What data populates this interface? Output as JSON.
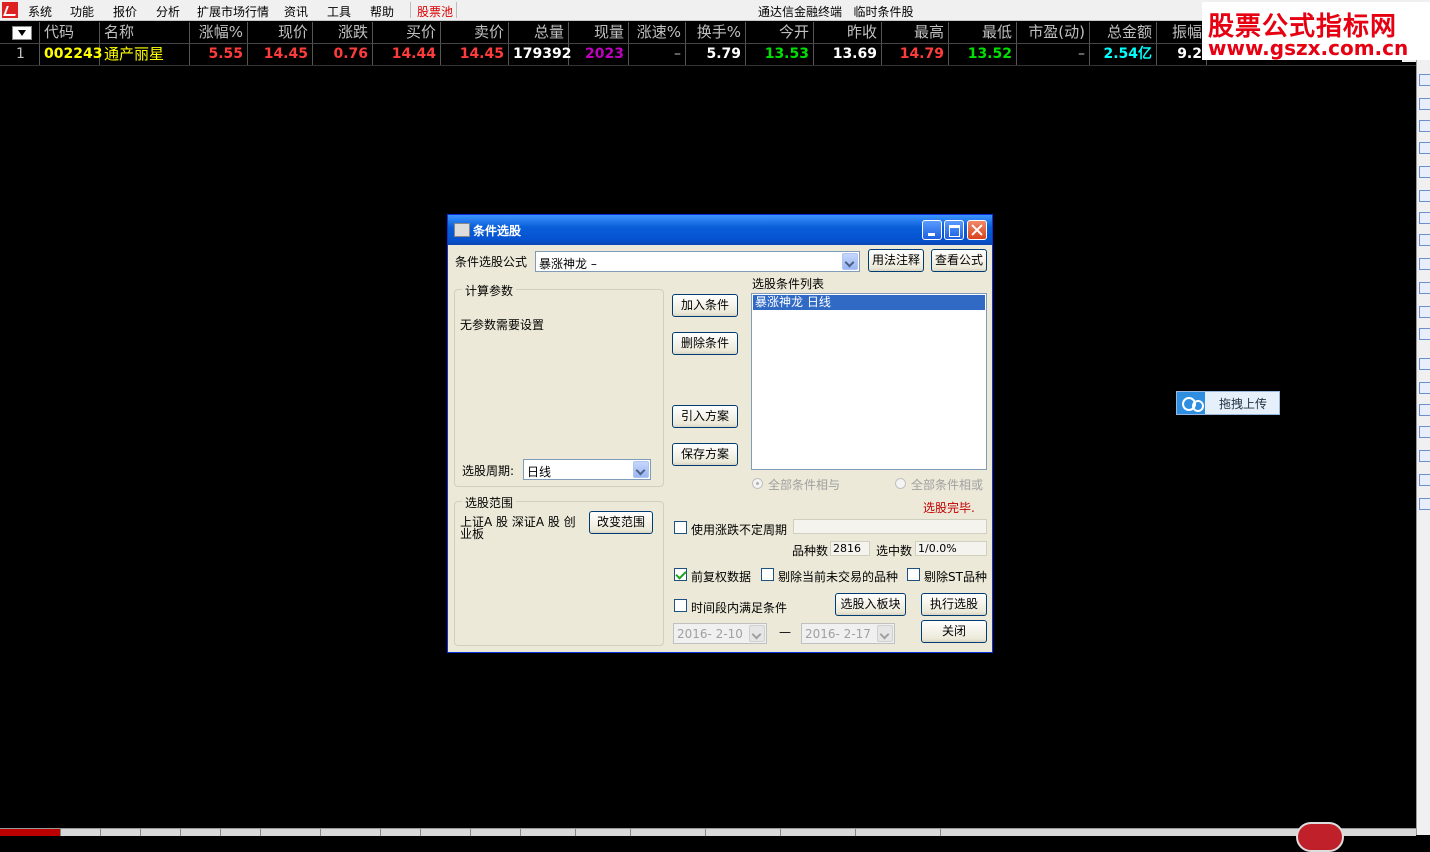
{
  "menubar": {
    "items": [
      "系统",
      "功能",
      "报价",
      "分析",
      "扩展市场行情",
      "资讯",
      "工具",
      "帮助",
      "股票池"
    ],
    "app_title": "通达信金融终端",
    "window_title": "临时条件股"
  },
  "watermark": {
    "line1": "股票公式指标网",
    "line2": "www.gszx.com.cn"
  },
  "table": {
    "headers": [
      "代码",
      "名称",
      "涨幅%",
      "现价",
      "涨跌",
      "买价",
      "卖价",
      "总量",
      "现量",
      "涨速%",
      "换手%",
      "今开",
      "昨收",
      "最高",
      "最低",
      "市盈(动)",
      "总金额",
      "振幅"
    ],
    "rows": [
      {
        "index": "1",
        "code": "002243",
        "name": "通产丽星",
        "change_pct": "5.55",
        "price": "14.45",
        "change": "0.76",
        "bid": "14.44",
        "ask": "14.45",
        "volume": "179392",
        "cur_vol": "2023",
        "speed": "–",
        "turnover": "5.79",
        "open": "13.53",
        "prev_close": "13.69",
        "high": "14.79",
        "low": "13.52",
        "pe": "–",
        "amount": "2.54亿",
        "amplitude": "9.2"
      }
    ]
  },
  "upload_button": {
    "label": "拖拽上传"
  },
  "dialog": {
    "title": "条件选股",
    "formula_label": "条件选股公式",
    "formula_value": "暴涨神龙        –",
    "usage_button": "用法注释",
    "view_formula_button": "查看公式",
    "params_group": "计算参数",
    "no_params_text": "无参数需要设置",
    "period_label": "选股周期:",
    "period_value": "日线",
    "range_group": "选股范围",
    "range_text": "上证A 股  深证A 股  创业板",
    "change_range_button": "改变范围",
    "add_condition": "加入条件",
    "delete_condition": "删除条件",
    "import_plan": "引入方案",
    "save_plan": "保存方案",
    "condition_list_label": "选股条件列表",
    "condition_items": [
      "暴涨神龙   日线"
    ],
    "radio_and": "全部条件相与",
    "radio_or": "全部条件相或",
    "status_text": "选股完毕.",
    "use_irregular_period": "使用涨跌不定周期",
    "variety_count_label": "品种数",
    "variety_count_value": "2816",
    "selected_count_label": "选中数",
    "selected_count_value": "1/0.0%",
    "forward_adjust": "前复权数据",
    "exclude_not_trading": "剔除当前未交易的品种",
    "exclude_st": "剔除ST品种",
    "time_range_condition": "时间段内满足条件",
    "to_block_button": "选股入板块",
    "execute_button": "执行选股",
    "date_from": "2016- 2-10",
    "date_sep": "—",
    "date_to": "2016- 2-17",
    "close_button": "关闭"
  },
  "colors": {
    "bg": "#000000",
    "up": "#ff3c3c",
    "down": "#00e000",
    "code": "#ffff00",
    "volume": "#ffffff",
    "cur_vol": "#c000c0",
    "amount": "#00ffff"
  }
}
